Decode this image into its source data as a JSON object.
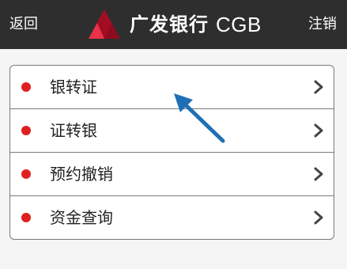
{
  "header": {
    "back_label": "返回",
    "brand_name_cn": "广发银行",
    "brand_name_en": "CGB",
    "logout_label": "注销",
    "background_color": "#2e2e2e"
  },
  "menu": {
    "items": [
      {
        "label": "银转证",
        "icon": "red-dot"
      },
      {
        "label": "证转银",
        "icon": "red-dot"
      },
      {
        "label": "预约撤销",
        "icon": "red-dot"
      },
      {
        "label": "资金查询",
        "icon": "red-dot"
      }
    ],
    "dot_color": "#e02020",
    "chevron_icon": "chevron-right-icon"
  },
  "annotation": {
    "icon": "blue-pointer-arrow",
    "color": "#1f6fb5"
  }
}
